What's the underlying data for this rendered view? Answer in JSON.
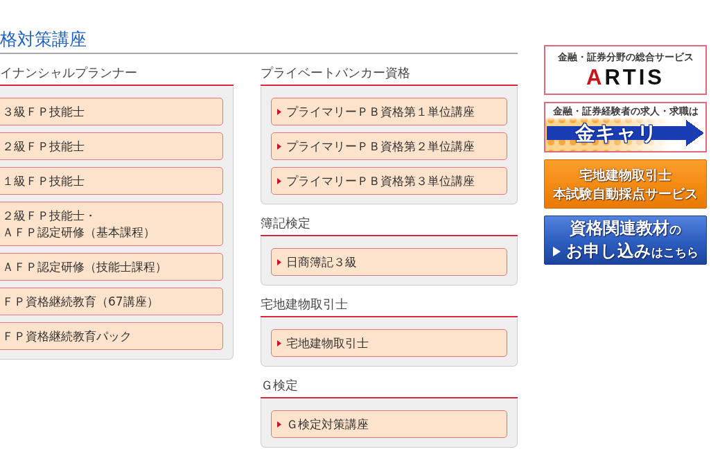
{
  "page": {
    "title": "格対策講座"
  },
  "columns": [
    {
      "sections": [
        {
          "heading": "イナンシャルプランナー",
          "markers": false,
          "items": [
            {
              "lines": [
                "３級ＦＰ技能士"
              ]
            },
            {
              "lines": [
                "２級ＦＰ技能士"
              ]
            },
            {
              "lines": [
                "１級ＦＰ技能士"
              ]
            },
            {
              "lines": [
                "２級ＦＰ技能士・",
                "ＡＦＰ認定研修（基本課程）"
              ]
            },
            {
              "lines": [
                "ＡＦＰ認定研修（技能士課程）"
              ]
            },
            {
              "lines": [
                "ＦＰ資格継続教育（67講座）"
              ]
            },
            {
              "lines": [
                "ＦＰ資格継続教育パック"
              ]
            }
          ]
        }
      ]
    },
    {
      "sections": [
        {
          "heading": "プライベートバンカー資格",
          "markers": true,
          "items": [
            {
              "lines": [
                "プライマリーＰＢ資格第１単位講座"
              ]
            },
            {
              "lines": [
                "プライマリーＰＢ資格第２単位講座"
              ]
            },
            {
              "lines": [
                "プライマリーＰＢ資格第３単位講座"
              ]
            }
          ]
        },
        {
          "heading": "簿記検定",
          "markers": true,
          "items": [
            {
              "lines": [
                "日商簿記３級"
              ]
            }
          ]
        },
        {
          "heading": "宅地建物取引士",
          "markers": true,
          "items": [
            {
              "lines": [
                "宅地建物取引士"
              ]
            }
          ]
        },
        {
          "heading": "Ｇ検定",
          "markers": true,
          "items": [
            {
              "lines": [
                "Ｇ検定対策講座"
              ]
            }
          ]
        }
      ]
    }
  ],
  "banners": [
    {
      "kind": "logo",
      "tagline": "金融・証券分野の総合サービス",
      "logo": "ARTIS"
    },
    {
      "kind": "arrow",
      "tagline": "金融・証券経験者の求人・求職は",
      "logo": "金キャリ"
    },
    {
      "kind": "orange",
      "lines": [
        {
          "pointer": false,
          "text": "宅地建物取引士"
        },
        {
          "pointer": false,
          "text": "本試験自動採点サービス"
        }
      ]
    },
    {
      "kind": "blue",
      "lines": [
        {
          "pointer": false,
          "text": "資格関連教材",
          "suffix": "の"
        },
        {
          "pointer": true,
          "text": "お申し込み",
          "suffix": "はこちら"
        }
      ]
    }
  ]
}
